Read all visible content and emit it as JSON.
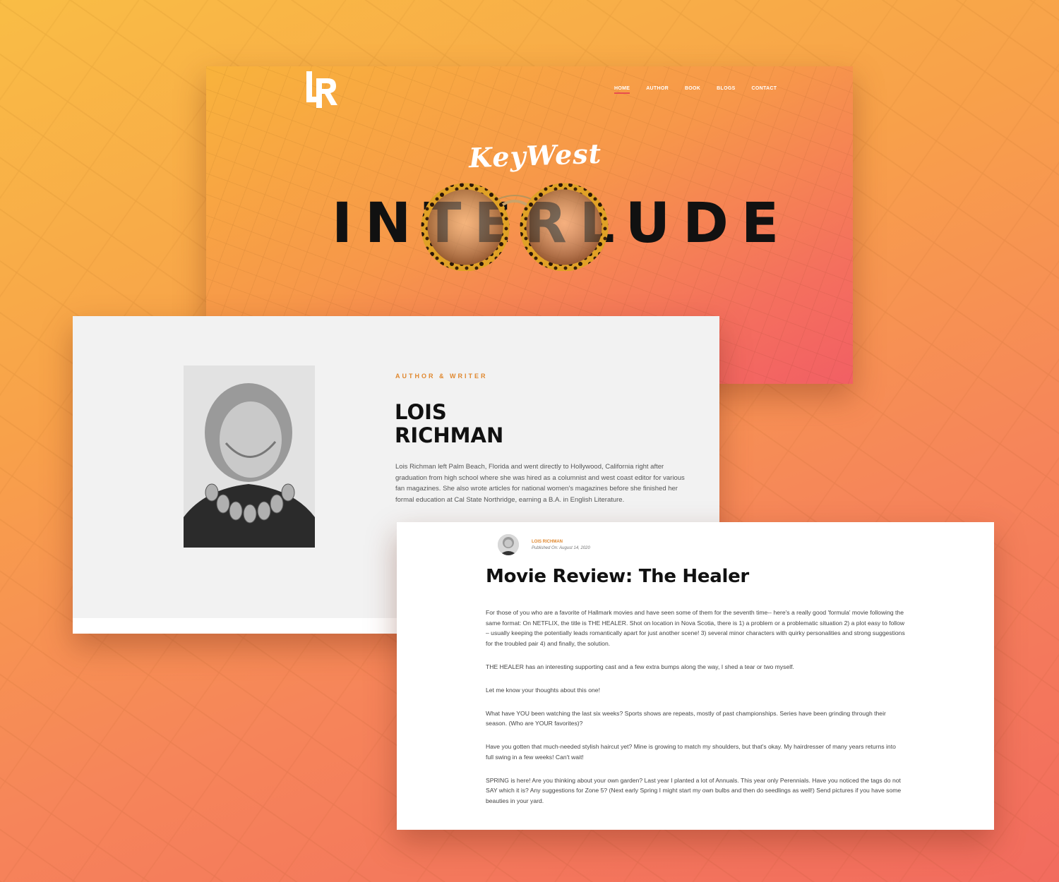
{
  "hero": {
    "nav": [
      "HOME",
      "AUTHOR",
      "BOOK",
      "BLOGS",
      "CONTACT"
    ],
    "active_nav": "HOME",
    "script_title": "KeyWest",
    "big_title": "INTERLUDE",
    "logo_text": "LR"
  },
  "author": {
    "eyebrow": "AUTHOR & WRITER",
    "name_line1": "LOIS",
    "name_line2": "RICHMAN",
    "bio": "Lois Richman left Palm Beach, Florida and went directly to Hollywood, California right after graduation from high school where she was hired as a columnist and west coast editor for various fan magazines. She also wrote articles for national women's magazines before she finished her formal education at Cal State Northridge, earning a B.A. in English Literature."
  },
  "blog": {
    "author": "LOIS RICHMAN",
    "published": "Published On: August 14, 2020",
    "title": "Movie Review: The Healer",
    "paragraphs": [
      "For those of you who are a favorite of Hallmark movies and have seen some of them for the seventh time-- here's a really good 'formula' movie following the same format: On NETFLIX, the title is THE HEALER. Shot on location in Nova Scotia, there is 1) a problem or a problematic situation 2) a plot easy to follow – usually keeping the potentially leads romantically apart for just another scene! 3) several minor characters with quirky personalities and strong suggestions for the troubled pair 4) and finally, the solution.",
      "THE HEALER has an interesting supporting cast and a few extra bumps along the way, I shed a tear or two myself.",
      "Let me know your thoughts about this one!",
      "What have YOU been watching the last six weeks? Sports shows are repeats, mostly of past championships. Series have been grinding through their season. (Who are YOUR favorites)?",
      "Have you gotten that much-needed stylish haircut yet? Mine is growing to match my shoulders, but that's okay. My hairdresser of many years returns into full swing in a few weeks! Can't wait!",
      "SPRING is here! Are you thinking about your own garden? Last year I planted a lot of Annuals. This year only Perennials. Have you noticed the tags do not SAY which it is? Any suggestions for Zone 5? (Next early Spring I might start my own bulbs and then do seedlings as well!) Send pictures if you have some beauties in your yard."
    ]
  },
  "colors": {
    "accent": "#e0882f",
    "nav_underline": "#e84e4e",
    "gradient_start": "#f8b33c",
    "gradient_end": "#f25f64"
  }
}
